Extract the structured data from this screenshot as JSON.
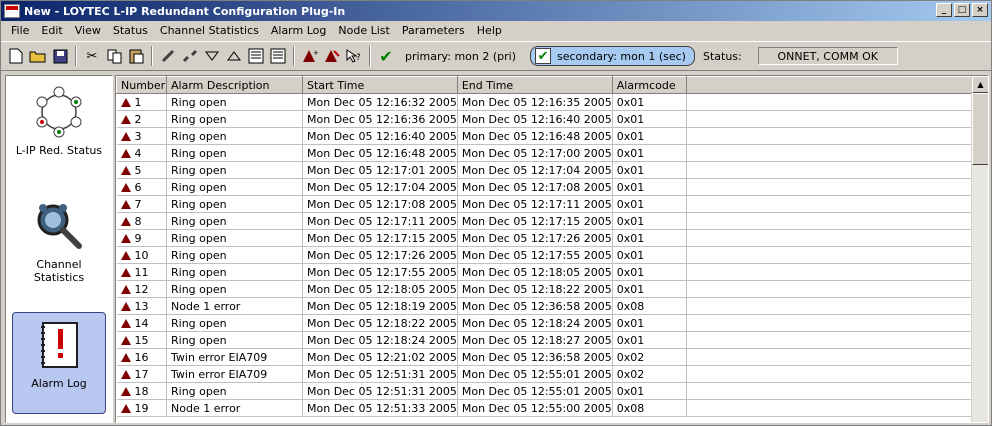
{
  "window": {
    "title": "New - LOYTEC L-IP Redundant Configuration Plug-In",
    "controls": [
      "_",
      "□",
      "×"
    ]
  },
  "menu": [
    "File",
    "Edit",
    "View",
    "Status",
    "Channel Statistics",
    "Alarm Log",
    "Node List",
    "Parameters",
    "Help"
  ],
  "toolbar": {
    "icons": [
      "new-icon",
      "open-icon",
      "save-icon",
      "cut-icon",
      "copy-icon",
      "paste-icon",
      "connect-icon",
      "disconnect-icon",
      "collapse-icon",
      "expand-icon",
      "export-icon",
      "import-icon",
      "alarm-add-icon",
      "alarm-clear-icon",
      "help-icon",
      "check-icon"
    ],
    "primary": "primary: mon 2 (pri)",
    "secondary": "secondary: mon 1 (sec)",
    "status_label": "Status:",
    "status_value": "ONNET, COMM OK"
  },
  "sidebar": {
    "items": [
      {
        "label": "L-IP Red. Status",
        "icon": "network-ring-icon",
        "active": false
      },
      {
        "label": "Channel Statistics",
        "icon": "magnifier-icon",
        "active": false
      },
      {
        "label": "Alarm Log",
        "icon": "alarm-log-icon",
        "active": true
      }
    ]
  },
  "alarm_table": {
    "columns": [
      "Number",
      "Alarm Description",
      "Start Time",
      "End Time",
      "Alarmcode"
    ],
    "rows": [
      [
        "1",
        "Ring open",
        "Mon Dec 05 12:16:32 2005",
        "Mon Dec 05 12:16:35 2005",
        "0x01"
      ],
      [
        "2",
        "Ring open",
        "Mon Dec 05 12:16:36 2005",
        "Mon Dec 05 12:16:40 2005",
        "0x01"
      ],
      [
        "3",
        "Ring open",
        "Mon Dec 05 12:16:40 2005",
        "Mon Dec 05 12:16:48 2005",
        "0x01"
      ],
      [
        "4",
        "Ring open",
        "Mon Dec 05 12:16:48 2005",
        "Mon Dec 05 12:17:00 2005",
        "0x01"
      ],
      [
        "5",
        "Ring open",
        "Mon Dec 05 12:17:01 2005",
        "Mon Dec 05 12:17:04 2005",
        "0x01"
      ],
      [
        "6",
        "Ring open",
        "Mon Dec 05 12:17:04 2005",
        "Mon Dec 05 12:17:08 2005",
        "0x01"
      ],
      [
        "7",
        "Ring open",
        "Mon Dec 05 12:17:08 2005",
        "Mon Dec 05 12:17:11 2005",
        "0x01"
      ],
      [
        "8",
        "Ring open",
        "Mon Dec 05 12:17:11 2005",
        "Mon Dec 05 12:17:15 2005",
        "0x01"
      ],
      [
        "9",
        "Ring open",
        "Mon Dec 05 12:17:15 2005",
        "Mon Dec 05 12:17:26 2005",
        "0x01"
      ],
      [
        "10",
        "Ring open",
        "Mon Dec 05 12:17:26 2005",
        "Mon Dec 05 12:17:55 2005",
        "0x01"
      ],
      [
        "11",
        "Ring open",
        "Mon Dec 05 12:17:55 2005",
        "Mon Dec 05 12:18:05 2005",
        "0x01"
      ],
      [
        "12",
        "Ring open",
        "Mon Dec 05 12:18:05 2005",
        "Mon Dec 05 12:18:22 2005",
        "0x01"
      ],
      [
        "13",
        "Node 1 error",
        "Mon Dec 05 12:18:19 2005",
        "Mon Dec 05 12:36:58 2005",
        "0x08"
      ],
      [
        "14",
        "Ring open",
        "Mon Dec 05 12:18:22 2005",
        "Mon Dec 05 12:18:24 2005",
        "0x01"
      ],
      [
        "15",
        "Ring open",
        "Mon Dec 05 12:18:24 2005",
        "Mon Dec 05 12:18:27 2005",
        "0x01"
      ],
      [
        "16",
        "Twin error EIA709",
        "Mon Dec 05 12:21:02 2005",
        "Mon Dec 05 12:36:58 2005",
        "0x02"
      ],
      [
        "17",
        "Twin error EIA709",
        "Mon Dec 05 12:51:31 2005",
        "Mon Dec 05 12:55:01 2005",
        "0x02"
      ],
      [
        "18",
        "Ring open",
        "Mon Dec 05 12:51:31 2005",
        "Mon Dec 05 12:55:01 2005",
        "0x01"
      ],
      [
        "19",
        "Node 1 error",
        "Mon Dec 05 12:51:33 2005",
        "Mon Dec 05 12:55:00 2005",
        "0x08"
      ]
    ]
  },
  "colors": {
    "titlebar": "#0a246a",
    "alarm_icon": "#800000",
    "active_sidebar": "#b8c8f0"
  }
}
